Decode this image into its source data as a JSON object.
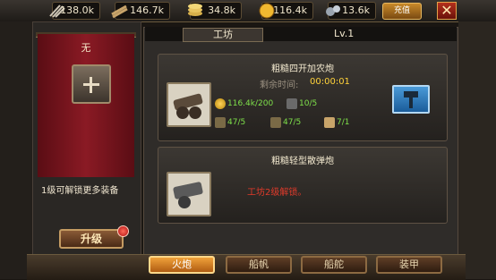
{
  "resources": [
    {
      "icon": "sword-rack-icon",
      "value": "138.0k"
    },
    {
      "icon": "wood-planks-icon",
      "value": "146.7k"
    },
    {
      "icon": "silver-ingot-icon",
      "value": "34.8k"
    },
    {
      "icon": "gold-coin-icon",
      "value": "116.4k"
    },
    {
      "icon": "iron-ore-icon",
      "value": "13.6k"
    }
  ],
  "recharge_label": "充值",
  "close_label": "✕",
  "left": {
    "banner_label": "无",
    "unlock_more": "1级可解锁更多装备",
    "upgrade_label": "升级"
  },
  "header": {
    "title": "工坊",
    "level": "Lv.1"
  },
  "items": [
    {
      "name": "粗糙四开加农炮",
      "remain_label": "剩余时间:",
      "remain_value": "00:00:01",
      "costs": [
        "116.4k/200",
        "10/5",
        "47/5",
        "47/5",
        "7/1"
      ]
    },
    {
      "name": "粗糙轻型散弹炮",
      "locked_text": "工坊2级解锁。"
    }
  ],
  "tabs": [
    {
      "label": "火炮",
      "active": true
    },
    {
      "label": "船帆",
      "active": false
    },
    {
      "label": "船舵",
      "active": false
    },
    {
      "label": "装甲",
      "active": false
    }
  ],
  "colors": {
    "accent": "#f0a23a",
    "locked": "#e03a2a",
    "timer": "#ffd23a",
    "cost_ok": "#7ee04a"
  }
}
